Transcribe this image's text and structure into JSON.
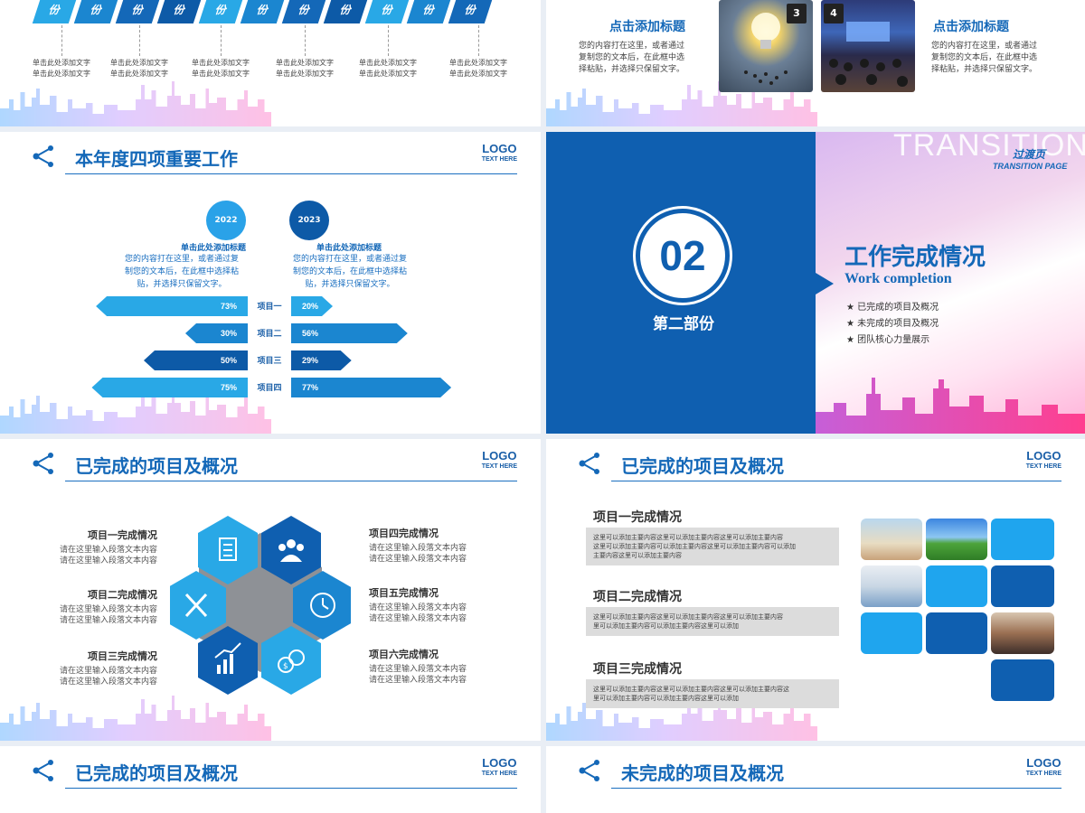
{
  "slide1": {
    "parallelograms": [
      "份",
      "份",
      "份",
      "份",
      "份",
      "份",
      "份",
      "份",
      "份",
      "份",
      "份"
    ],
    "captions": [
      [
        "单击此处添加文字",
        "单击此处添加文字"
      ],
      [
        "单击此处添加文字",
        "单击此处添加文字"
      ],
      [
        "单击此处添加文字",
        "单击此处添加文字"
      ],
      [
        "单击此处添加文字",
        "单击此处添加文字"
      ],
      [
        "单击此处添加文字",
        "单击此处添加文字"
      ],
      [
        "单击此处添加文字",
        "单击此处添加文字"
      ]
    ]
  },
  "slide2": {
    "left_title": "点击添加标题",
    "left_body": [
      "您的内容打在这里，或者通过",
      "复制您的文本后，在此框中选",
      "择粘贴，并选择只保留文字。"
    ],
    "badge3": "3",
    "badge4": "4",
    "right_title": "点击添加标题",
    "right_body": [
      "您的内容打在这里，或者通过",
      "复制您的文本后，在此框中选",
      "择粘贴，并选择只保留文字。"
    ]
  },
  "slide3": {
    "title": "本年度四项重要工作",
    "logo": "LOGO",
    "logo_sub": "TEXT HERE",
    "year_left": "2022",
    "year_right": "2023",
    "sub_left": "单击此处添加标题",
    "sub_right": "单击此处添加标题",
    "body_left": [
      "您的内容打在这里，或者通过复",
      "制您的文本后，在此框中选择粘",
      "贴，并选择只保留文字。"
    ],
    "body_right": [
      "您的内容打在这里，或者通过复",
      "制您的文本后，在此框中选择粘",
      "贴，并选择只保留文字。"
    ],
    "rows": [
      {
        "label": "项目一",
        "left": "73%",
        "right": "20%"
      },
      {
        "label": "项目二",
        "left": "30%",
        "right": "56%"
      },
      {
        "label": "项目三",
        "left": "50%",
        "right": "29%"
      },
      {
        "label": "项目四",
        "left": "75%",
        "right": "77%"
      }
    ]
  },
  "chart_data": {
    "type": "bar",
    "categories": [
      "项目一",
      "项目二",
      "项目三",
      "项目四"
    ],
    "series": [
      {
        "name": "2022",
        "values": [
          73,
          30,
          50,
          75
        ]
      },
      {
        "name": "2023",
        "values": [
          20,
          56,
          29,
          77
        ]
      }
    ],
    "title": "本年度四项重要工作",
    "xlabel": "",
    "ylabel": "",
    "ylim": [
      0,
      100
    ]
  },
  "slide4": {
    "big_number": "02",
    "part": "第二部份",
    "watermark": "TRANSITION",
    "tag_cn": "过渡页",
    "tag_en": "TRANSITION PAGE",
    "title_cn": "工作完成情况",
    "title_en": "Work completion",
    "bullets": [
      "★ 已完成的项目及概况",
      "★ 未完成的项目及概况",
      "★ 团队核心力量展示"
    ]
  },
  "slide5": {
    "title": "已完成的项目及概况",
    "logo": "LOGO",
    "logo_sub": "TEXT HERE",
    "left_items": [
      {
        "title": "项目一完成情况",
        "lines": [
          "请在这里输入段落文本内容",
          "请在这里输入段落文本内容"
        ]
      },
      {
        "title": "项目二完成情况",
        "lines": [
          "请在这里输入段落文本内容",
          "请在这里输入段落文本内容"
        ]
      },
      {
        "title": "项目三完成情况",
        "lines": [
          "请在这里输入段落文本内容",
          "请在这里输入段落文本内容"
        ]
      }
    ],
    "right_items": [
      {
        "title": "项目四完成情况",
        "lines": [
          "请在这里输入段落文本内容",
          "请在这里输入段落文本内容"
        ]
      },
      {
        "title": "项目五完成情况",
        "lines": [
          "请在这里输入段落文本内容",
          "请在这里输入段落文本内容"
        ]
      },
      {
        "title": "项目六完成情况",
        "lines": [
          "请在这里输入段落文本内容",
          "请在这里输入段落文本内容"
        ]
      }
    ]
  },
  "slide6": {
    "title": "已完成的项目及概况",
    "logo": "LOGO",
    "logo_sub": "TEXT HERE",
    "items": [
      {
        "title": "项目一完成情况",
        "lines": [
          "这里可以添加主要内容这里可以添加主要内容这里可以添加主要内容",
          "这里可以添加主要内容可以添加主要内容这里可以添加主要内容可以添加",
          "主要内容这里可以添加主要内容"
        ]
      },
      {
        "title": "项目二完成情况",
        "lines": [
          "这里可以添加主要内容这里可以添加主要内容这里可以添加主要内容",
          "里可以添加主要内容可以添加主要内容这里可以添加"
        ]
      },
      {
        "title": "项目三完成情况",
        "lines": [
          "这里可以添加主要内容这里可以添加主要内容这里可以添加主要内容这",
          "里可以添加主要内容可以添加主要内容这里可以添加"
        ]
      }
    ]
  },
  "slide7": {
    "title": "已完成的项目及概况",
    "logo": "LOGO",
    "logo_sub": "TEXT HERE"
  },
  "slide8": {
    "title": "未完成的项目及概况",
    "logo": "LOGO",
    "logo_sub": "TEXT HERE"
  },
  "colors": {
    "primary": "#1468b8",
    "light": "#29a8e6",
    "mid": "#1b86d0",
    "dark": "#0d5aa7",
    "pink": "#ff5aa0"
  }
}
